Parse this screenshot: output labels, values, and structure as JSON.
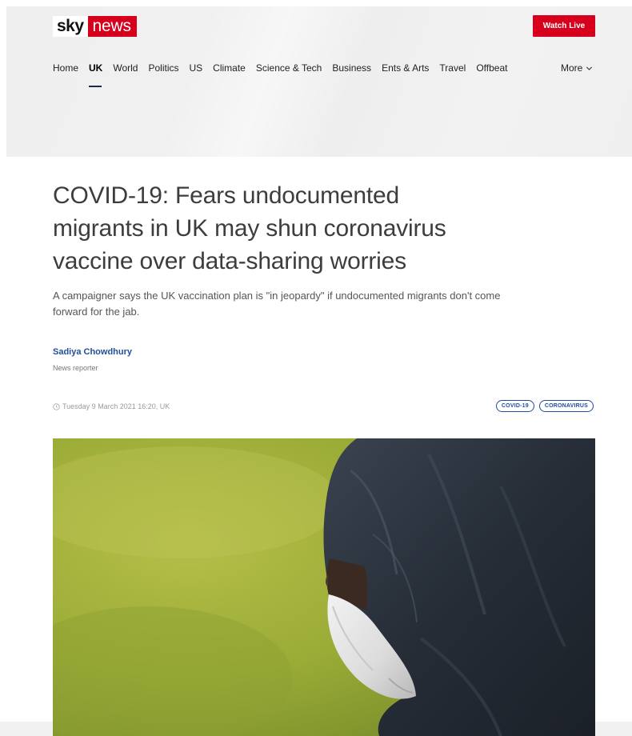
{
  "header": {
    "logo": {
      "sky": "sky",
      "news": "news"
    },
    "watch_live": "Watch Live",
    "nav": [
      {
        "label": "Home"
      },
      {
        "label": "UK",
        "active": true
      },
      {
        "label": "World"
      },
      {
        "label": "Politics"
      },
      {
        "label": "US"
      },
      {
        "label": "Climate"
      },
      {
        "label": "Science & Tech"
      },
      {
        "label": "Business"
      },
      {
        "label": "Ents & Arts"
      },
      {
        "label": "Travel"
      },
      {
        "label": "Offbeat"
      }
    ],
    "more": "More",
    "more_icon": "chevron-down-icon"
  },
  "article": {
    "headline": "COVID-19: Fears undocumented migrants in UK may shun coronavirus vaccine over data-sharing worries",
    "standfirst": "A campaigner says the UK vaccination plan is \"in jeopardy\" if undocumented migrants don't come forward for the jab.",
    "author": {
      "name": "Sadiya Chowdhury",
      "role": "News reporter"
    },
    "timestamp_icon": "clock-icon",
    "timestamp": "Tuesday 9 March 2021 16:20, UK",
    "tags": [
      {
        "label": "COVID-19"
      },
      {
        "label": "CORONAVIRUS"
      }
    ]
  },
  "colors": {
    "brand_red": "#d6001c",
    "link_blue": "#1f4e9c",
    "masthead_bg": "#f0f0f0"
  }
}
